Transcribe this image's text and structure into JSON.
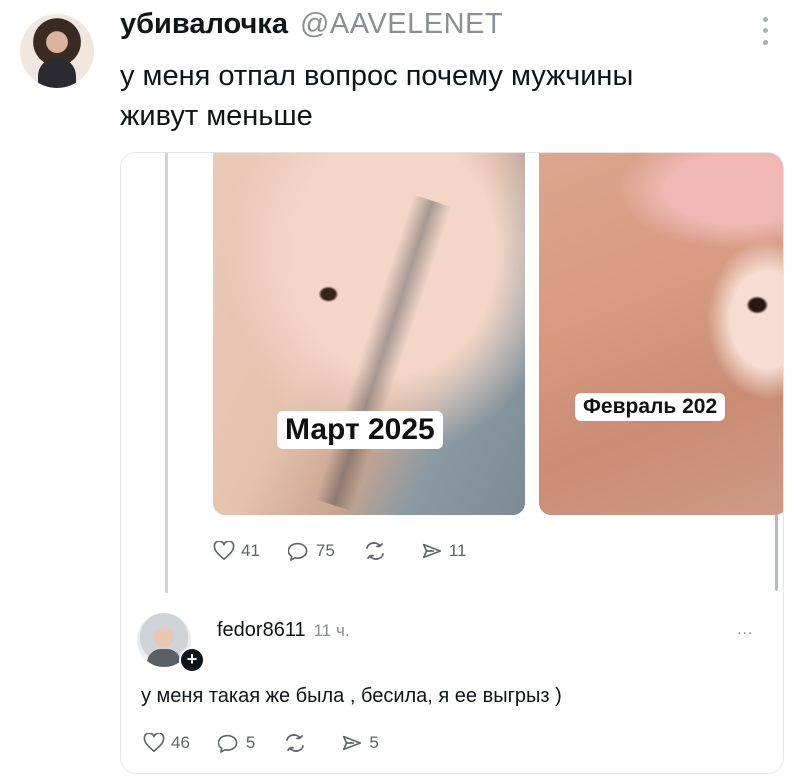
{
  "tweet": {
    "display_name": "убивалочка",
    "handle": "@AAVELENET",
    "text_line1": "у меня отпал вопрос почему мужчины",
    "text_line2": "живут меньше",
    "more_icon": "more-vertical-icon"
  },
  "embedded": {
    "photos": [
      {
        "label": "Март 2025"
      },
      {
        "label": "Февраль 202"
      }
    ],
    "stats": {
      "likes": "41",
      "replies": "75",
      "reposts": "",
      "views": "11"
    },
    "reply": {
      "username": "fedor8611",
      "time": "11 ч.",
      "more": "...",
      "follow_badge": "+",
      "text": "у меня такая же была , бесила, я ее выгрыз )",
      "stats": {
        "likes": "46",
        "replies": "5",
        "reposts": "",
        "views": "5"
      }
    }
  }
}
